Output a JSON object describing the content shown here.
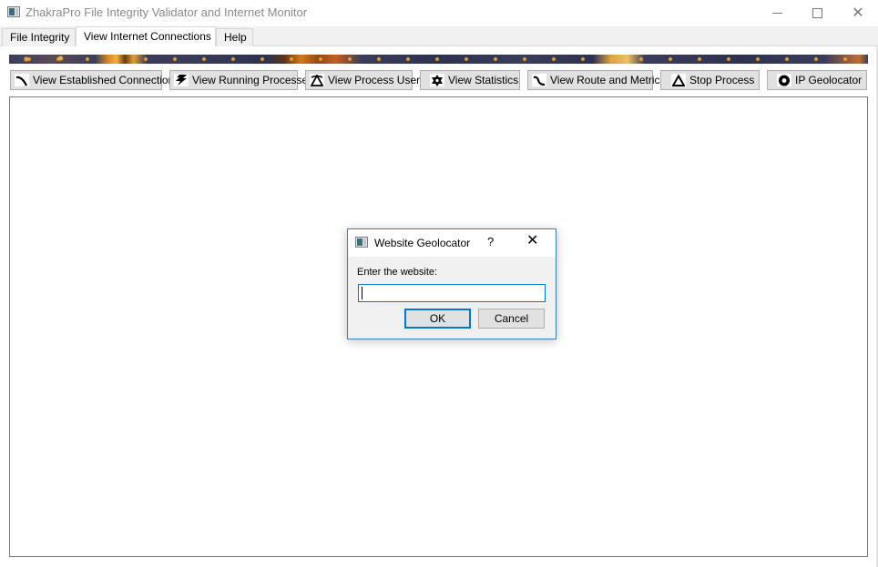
{
  "window": {
    "title": "ZhakraPro File Integrity Validator and Internet Monitor",
    "icon": "app-window-icon",
    "controls": {
      "minimize": "minimize-icon",
      "maximize": "maximize-icon",
      "close": "✕"
    }
  },
  "tabs": [
    {
      "label": "File Integrity",
      "active": false
    },
    {
      "label": "View Internet Connections",
      "active": true
    },
    {
      "label": "Help",
      "active": false
    }
  ],
  "banner": {
    "icon": "decorative-banner-image"
  },
  "toolbar": {
    "buttons": [
      {
        "label": "View Established Connections",
        "icon": "curve-icon"
      },
      {
        "label": "View Running Processes",
        "icon": "lightning-icon"
      },
      {
        "label": "View Process Users",
        "icon": "triangle-users-icon"
      },
      {
        "label": "View Statistics",
        "icon": "star-of-david-icon"
      },
      {
        "label": "View Route and Metrics",
        "icon": "route-curve-icon"
      },
      {
        "label": "Stop Process",
        "icon": "triangle-icon"
      },
      {
        "label": "IP Geolocator",
        "icon": "globe-ring-icon"
      }
    ]
  },
  "panel": {
    "content": ""
  },
  "dialog": {
    "title": "Website Geolocator",
    "help": "?",
    "close": "✕",
    "label": "Enter the website:",
    "input_value": "",
    "ok_label": "OK",
    "cancel_label": "Cancel"
  },
  "colors": {
    "accent": "#0078d7",
    "dialog_border": "#3c7fb1",
    "button_bg": "#e1e1e1",
    "button_border": "#adadad",
    "title_text": "#8a8a8a"
  }
}
